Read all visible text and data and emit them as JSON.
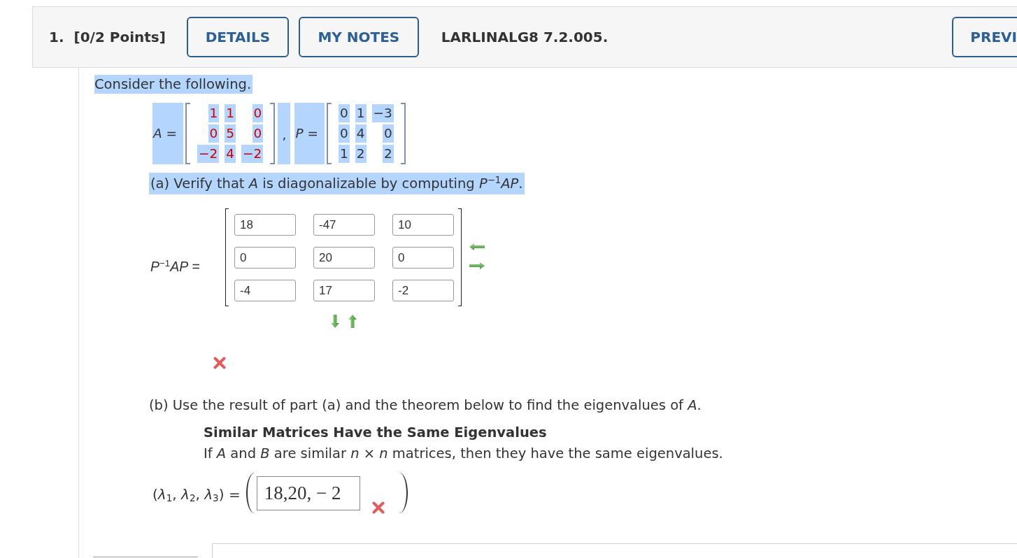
{
  "header": {
    "number": "1.",
    "points": "[0/2 Points]",
    "buttons": [
      "DETAILS",
      "MY NOTES"
    ],
    "code": "LARLINALG8 7.2.005.",
    "nav_button": "PREVI"
  },
  "problem": {
    "intro": {
      "text": "Consider the following.",
      "highlighted": true
    },
    "given": {
      "highlighted": true,
      "separator": ",",
      "matrices": [
        {
          "label": "*A* =",
          "color": "#cc0000",
          "rows": [
            [
              "1",
              "1",
              "0"
            ],
            [
              "0",
              "5",
              "0"
            ],
            [
              "−2",
              "4",
              "−2"
            ]
          ]
        },
        {
          "label": "*P* =",
          "color": "#333333",
          "rows": [
            [
              "0",
              "1",
              "−3"
            ],
            [
              "0",
              "4",
              "0"
            ],
            [
              "1",
              "2",
              "2"
            ]
          ]
        }
      ]
    },
    "part_a": {
      "prompt": {
        "text": "(a) Verify that *A* is diagonalizable by computing  *P*$^{−1}$*AP*.",
        "highlighted": true
      },
      "label": "*P*$^{−1}$*AP* =",
      "entries": [
        [
          "18",
          "-47",
          "10"
        ],
        [
          "0",
          "20",
          "0"
        ],
        [
          "-4",
          "17",
          "-2"
        ]
      ],
      "correct": false
    },
    "part_b": {
      "prompt": "(b) Use the result of part (a) and the theorem below to find the eigenvalues of *A*.",
      "theorem_title": "Similar Matrices Have the Same Eigenvalues",
      "theorem_text": "If *A* and *B* are similar *n* × *n* matrices, then they have the same eigenvalues.",
      "answer_label": "(*λ*$_{1}$, *λ*$_{2}$, *λ*$_{3}$) =",
      "answer": "18,20, − 2",
      "correct": false
    }
  }
}
